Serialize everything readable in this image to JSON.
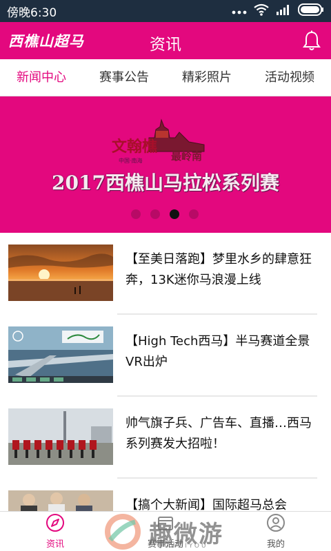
{
  "status_bar": {
    "time": "傍晚6:30"
  },
  "header": {
    "brand": "西樵山超马",
    "title": "资讯"
  },
  "tabs": [
    {
      "label": "新闻中心",
      "active": true
    },
    {
      "label": "赛事公告",
      "active": false
    },
    {
      "label": "精彩照片",
      "active": false
    },
    {
      "label": "活动视频",
      "active": false
    }
  ],
  "banner": {
    "logo_text": "文翰樵",
    "logo_sub": "最岭南",
    "logo_caption": "中国·南海",
    "title": "2017西樵山马拉松系列赛",
    "slide_count": 4,
    "active_slide": 3
  },
  "news": [
    {
      "headline": "【至美日落跑】梦里水乡的肆意狂奔，13K迷你马浪漫上线",
      "thumb": "sunset-photo"
    },
    {
      "headline": "【High Tech西马】半马赛道全景VR出炉",
      "thumb": "vr-bridge-photo"
    },
    {
      "headline": "帅气旗子兵、广告车、直播…西马系列赛发大招啦！",
      "thumb": "flag-team-photo"
    },
    {
      "headline": "【搞个大新闻】国际超马总会",
      "thumb": "people-photo"
    }
  ],
  "bottom_nav": [
    {
      "label": "资讯",
      "icon": "compass-icon",
      "active": true
    },
    {
      "label": "赛事活动",
      "icon": "event-icon",
      "active": false
    },
    {
      "label": "我的",
      "icon": "user-icon",
      "active": false
    }
  ],
  "watermark": {
    "text": "趣微游",
    "sub": "QUWEIYOU"
  },
  "colors": {
    "accent": "#e3087e",
    "status_bar": "#1e2e40"
  }
}
